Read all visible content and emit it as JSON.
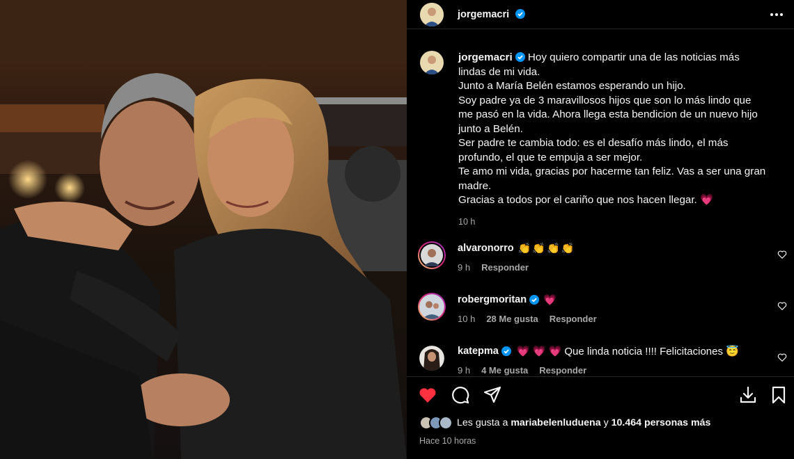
{
  "post": {
    "author": "jorgemacri",
    "caption_lines": [
      "Hoy quiero compartir una de las noticias más",
      "lindas de mi vida.",
      "Junto a María Belén estamos esperando un hijo.",
      "Soy padre ya de 3 maravillosos hijos que son lo más lindo que",
      "me pasó en la vida. Ahora llega esta bendicion de un nuevo hijo",
      "junto a Belén.",
      "Ser padre te cambia todo: es el desafío más lindo, el más",
      "profundo, el que te empuja a ser mejor.",
      "Te amo mi vida, gracias por hacerme tan feliz. Vas a ser una gran",
      "madre.",
      "Gracias a todos por el cariño que nos hacen llegar. 💗"
    ],
    "caption_time": "10 h"
  },
  "comments": [
    {
      "user": "alvaronorro",
      "text": "👏👏👏👏",
      "time": "9 h",
      "likes": "",
      "reply": "Responder"
    },
    {
      "user": "robergmoritan",
      "text": "💗",
      "time": "10 h",
      "likes": "28 Me gusta",
      "reply": "Responder"
    },
    {
      "user": "katepma",
      "text": "💗 💗 💗 Que linda noticia !!!! Felicitaciones 😇",
      "time": "9 h",
      "likes": "4 Me gusta",
      "reply": "Responder"
    }
  ],
  "likes": {
    "prefix": "Les gusta a",
    "first_user": "mariabelenluduena",
    "connector": "y",
    "others": "10.464 personas más"
  },
  "posted_ago": "Hace 10 horas",
  "colors": {
    "like_red": "#ff3040",
    "verified_blue": "#0095f6",
    "muted": "#a8a8a8",
    "divider": "#262626"
  },
  "icons": [
    "more-options-icon",
    "verified-icon",
    "heart-icon",
    "comment-icon",
    "share-icon",
    "download-icon",
    "bookmark-icon"
  ]
}
